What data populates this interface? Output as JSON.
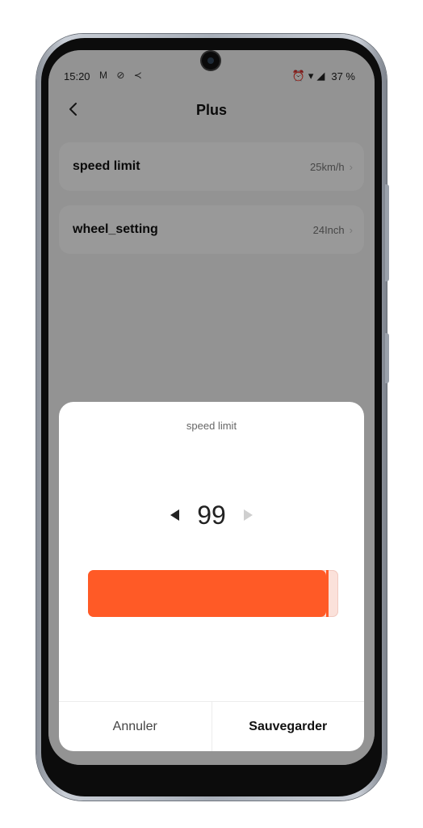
{
  "status_bar": {
    "time": "15:20",
    "left_icons": "M ⊘ ≺",
    "battery": "37 %"
  },
  "header": {
    "title": "Plus"
  },
  "settings": [
    {
      "label": "speed limit",
      "value": "25km/h"
    },
    {
      "label": "wheel_setting",
      "value": "24Inch"
    }
  ],
  "dialog": {
    "title": "speed limit",
    "value": "99",
    "slider_fraction": 0.95,
    "cancel_label": "Annuler",
    "save_label": "Sauvegarder"
  },
  "colors": {
    "accent": "#ff5a26",
    "accent_light": "#fbe1da"
  },
  "icons": {
    "back": "chevron-left-icon",
    "row_chevron": "chevron-right-icon",
    "decrease": "triangle-left-icon",
    "increase": "triangle-right-icon",
    "alarm": "alarm-icon",
    "wifi": "wifi-icon",
    "signal": "signal-icon"
  }
}
